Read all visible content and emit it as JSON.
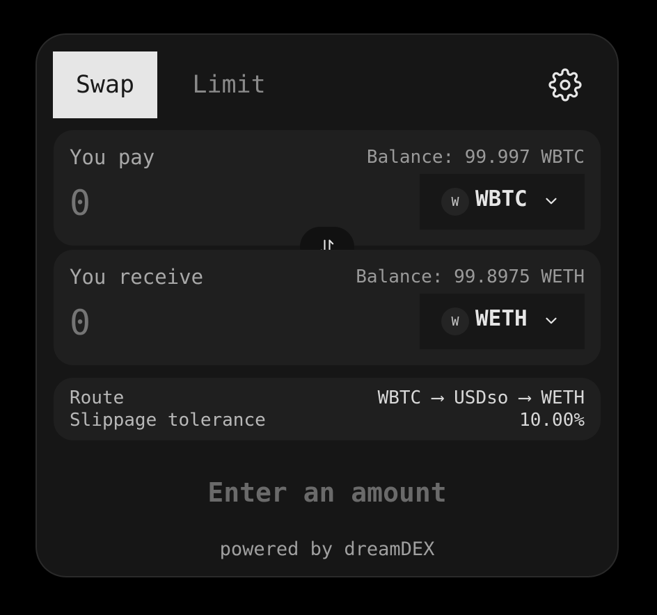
{
  "tabs": {
    "swap_label": "Swap",
    "limit_label": "Limit"
  },
  "pay": {
    "label": "You pay",
    "balance": "Balance: 99.997 WBTC",
    "amount_placeholder": "0",
    "token": {
      "badge": "W",
      "symbol": "WBTC"
    }
  },
  "receive": {
    "label": "You receive",
    "balance": "Balance: 99.8975 WETH",
    "amount_placeholder": "0",
    "token": {
      "badge": "W",
      "symbol": "WETH"
    }
  },
  "details": {
    "route_label": "Route",
    "route_value": "WBTC ⟶ USDso ⟶ WETH",
    "slippage_label": "Slippage tolerance",
    "slippage_value": "10.00%"
  },
  "cta_label": "Enter an amount",
  "footer_text": "powered by dreamDEX",
  "icons": {
    "settings": "gear-icon",
    "swap_direction": "swap-vertical-arrows-icon",
    "dropdown": "chevron-down-icon"
  },
  "colors": {
    "background": "#000000",
    "card": "#161616",
    "panel": "#1f1f1f",
    "active_tab": "#e6e6e6",
    "muted_text": "#8a8a8a"
  }
}
